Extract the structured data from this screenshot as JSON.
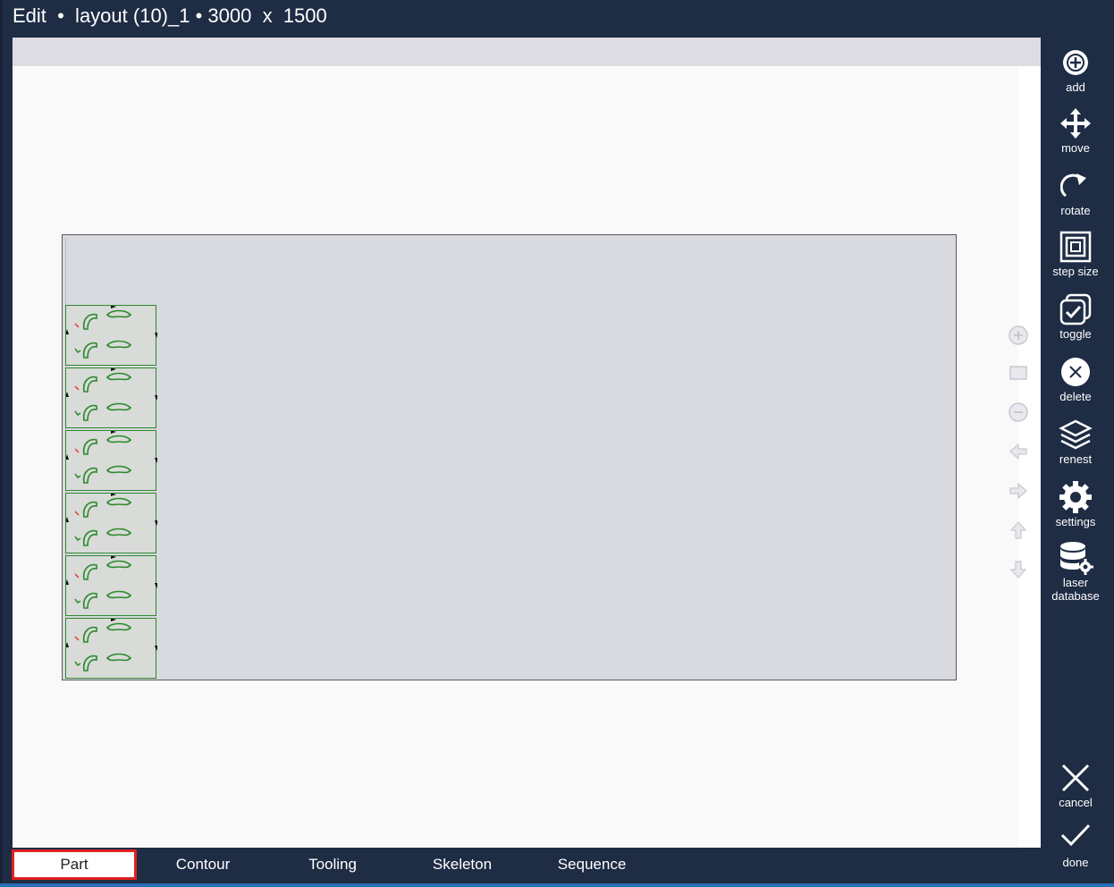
{
  "window": {
    "title": "Edit  •  layout (10)_1 • 3000  x  1500"
  },
  "canvas": {
    "part_count": 6
  },
  "nav_tools": [
    {
      "name": "zoom-in-icon"
    },
    {
      "name": "fit-view-icon"
    },
    {
      "name": "zoom-out-icon"
    },
    {
      "name": "pan-left-icon"
    },
    {
      "name": "pan-right-icon"
    },
    {
      "name": "pan-up-icon"
    },
    {
      "name": "pan-down-icon"
    }
  ],
  "toolbar": {
    "add": "add",
    "move": "move",
    "rotate": "rotate",
    "step_size": "step size",
    "toggle": "toggle",
    "delete": "delete",
    "renest": "renest",
    "settings": "settings",
    "laser_database_1": "laser",
    "laser_database_2": "database",
    "cancel": "cancel",
    "done": "done"
  },
  "tabs": {
    "part": "Part",
    "contour": "Contour",
    "tooling": "Tooling",
    "skeleton": "Skeleton",
    "sequence": "Sequence",
    "active": "Part"
  },
  "colors": {
    "background": "#1e2c44",
    "sheet": "#d9d9e0",
    "part_outline": "#2c8a2c",
    "active_tab_border": "#e02020",
    "accent": "#2a6fb8"
  }
}
